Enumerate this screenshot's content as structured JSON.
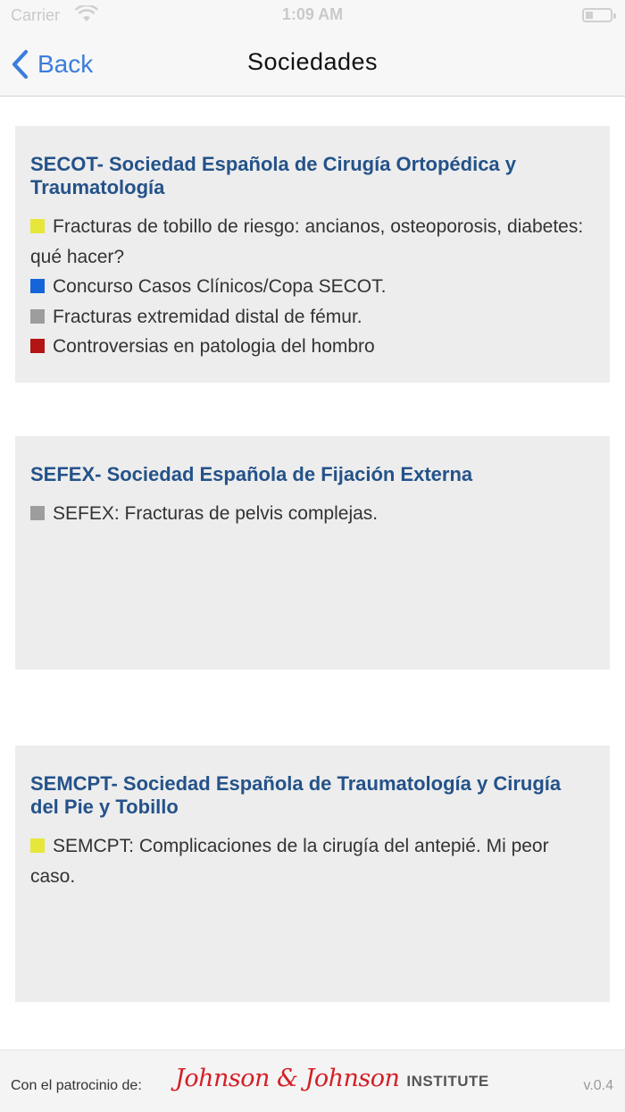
{
  "status_bar": {
    "carrier": "Carrier",
    "time": "1:09 AM"
  },
  "nav": {
    "back_label": "Back",
    "title": "Sociedades"
  },
  "colors": {
    "yellow": "#e7e63a",
    "blue": "#1565d8",
    "gray": "#9d9d9d",
    "red": "#b31414",
    "title_blue": "#245289",
    "link_blue": "#3b7ddd"
  },
  "societies": [
    {
      "title": "SECOT- Sociedad Española de Cirugía Ortopédica y Traumatología",
      "items": [
        {
          "color": "yellow",
          "text": "Fracturas de tobillo de riesgo: ancianos, osteoporosis, diabetes: qué hacer?"
        },
        {
          "color": "blue",
          "text": "Concurso Casos Clínicos/Copa SECOT."
        },
        {
          "color": "gray",
          "text": "Fracturas extremidad distal de fémur."
        },
        {
          "color": "red",
          "text": "Controversias en patologia del hombro"
        }
      ]
    },
    {
      "title": "SEFEX- Sociedad Española de Fijación Externa",
      "items": [
        {
          "color": "gray",
          "text": "SEFEX: Fracturas de pelvis complejas."
        }
      ]
    },
    {
      "title": "SEMCPT- Sociedad Española de Traumatología y Cirugía del Pie y Tobillo",
      "items": [
        {
          "color": "yellow",
          "text": "SEMCPT: Complicaciones de la cirugía del antepié. Mi peor caso."
        }
      ]
    }
  ],
  "footer": {
    "sponsor_label": "Con el patrocinio de:",
    "logo_text": "Johnson & Johnson",
    "logo_suffix": "INSTITUTE",
    "version": "v.0.4"
  }
}
